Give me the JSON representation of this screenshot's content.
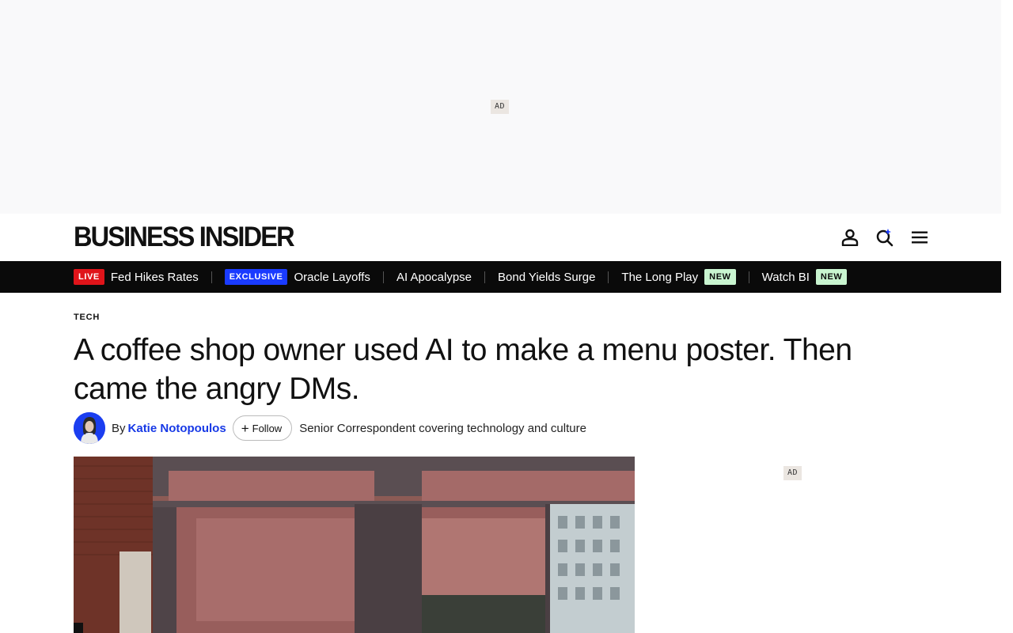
{
  "ads": {
    "top_label": "AD",
    "side_label": "AD"
  },
  "header": {
    "logo_text": "BUSINESS INSIDER",
    "icons": [
      "account-icon",
      "search-icon",
      "menu-icon"
    ],
    "accent_color": "#1a3bff"
  },
  "ticker": {
    "items": [
      {
        "badge": "LIVE",
        "label": "Fed Hikes Rates"
      },
      {
        "badge": "EXCLUSIVE",
        "label": "Oracle Layoffs"
      },
      {
        "label": "AI Apocalypse"
      },
      {
        "label": "Bond Yields Surge"
      },
      {
        "label": "The Long Play",
        "tag": "NEW"
      },
      {
        "label": "Watch BI",
        "tag": "NEW"
      }
    ]
  },
  "article": {
    "section": "TECH",
    "headline": "A coffee shop owner used AI to make a menu poster. Then came the angry DMs.",
    "byline_prefix": "By",
    "author": "Katie Notopoulos",
    "follow_label": "Follow",
    "author_description": "Senior Correspondent covering technology and culture"
  },
  "colors": {
    "live": "#e0141a",
    "exclusive": "#1a3bff",
    "new_badge": "#c9f5d0",
    "author_link": "#1739e6"
  }
}
